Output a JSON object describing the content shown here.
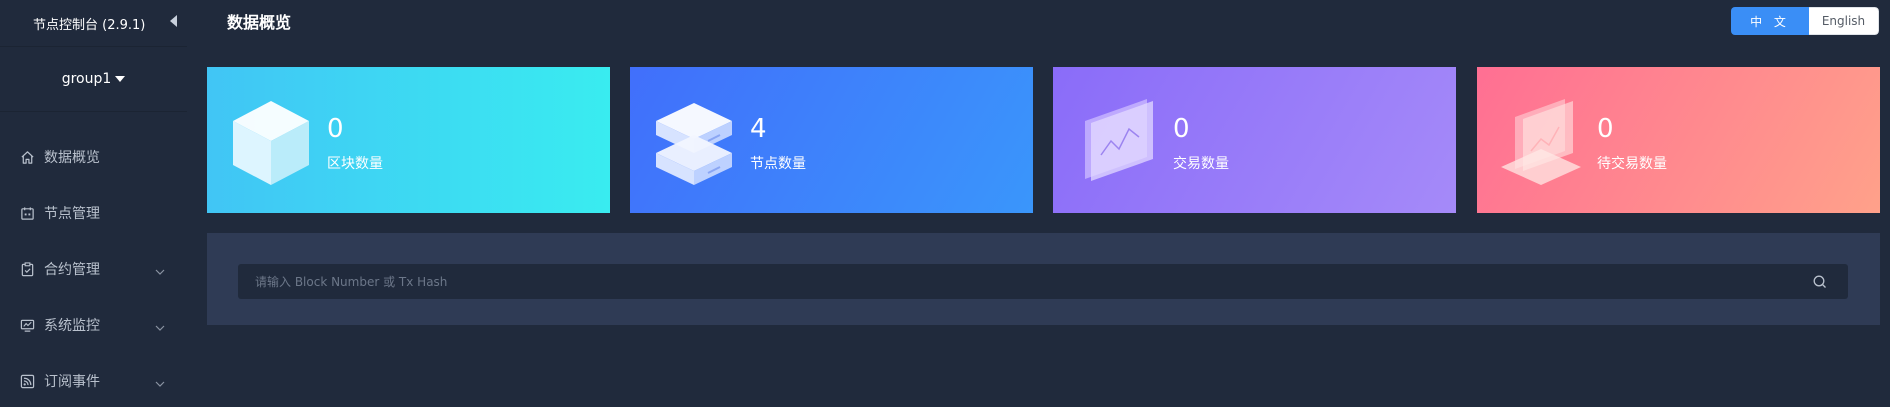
{
  "sidebar": {
    "brand_title": "节点控制台 (2.9.1)",
    "group": "group1",
    "items": [
      {
        "label": "数据概览",
        "icon": "home-icon",
        "has_submenu": false
      },
      {
        "label": "节点管理",
        "icon": "calendar-icon",
        "has_submenu": false
      },
      {
        "label": "合约管理",
        "icon": "clipboard-icon",
        "has_submenu": true
      },
      {
        "label": "系统监控",
        "icon": "monitor-chart-icon",
        "has_submenu": true
      },
      {
        "label": "订阅事件",
        "icon": "rss-icon",
        "has_submenu": true
      }
    ]
  },
  "header": {
    "title": "数据概览",
    "lang": {
      "zh": "中 文",
      "en": "English",
      "active": "zh"
    }
  },
  "stats": [
    {
      "value": "0",
      "label": "区块数量",
      "icon": "cube-icon"
    },
    {
      "value": "4",
      "label": "节点数量",
      "icon": "server-stack-icon"
    },
    {
      "value": "0",
      "label": "交易数量",
      "icon": "transaction-screen-icon"
    },
    {
      "value": "0",
      "label": "待交易数量",
      "icon": "pending-transaction-icon"
    }
  ],
  "search": {
    "placeholder": "请输入 Block Number 或 Tx Hash",
    "value": ""
  },
  "colors": {
    "background": "#202a3c",
    "panel": "#2f3b55",
    "accent": "#3a8ef6"
  }
}
